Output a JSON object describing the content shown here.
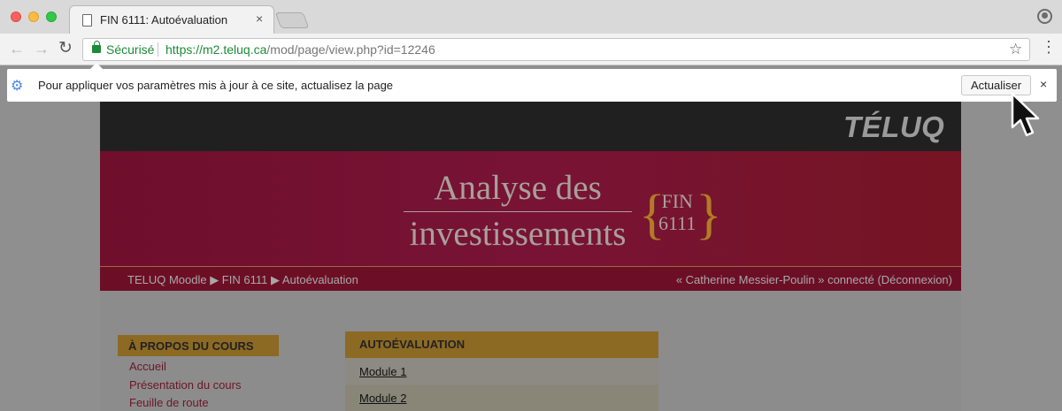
{
  "browser": {
    "tab_title": "FIN 6111: Autoévaluation",
    "close_glyph": "×",
    "secure_label": "Sécurisé",
    "url_host": "https://m2.teluq.ca",
    "url_path": "/mod/page/view.php?id=12246"
  },
  "infobar": {
    "message": "Pour appliquer vos paramètres mis à jour à ce site, actualisez la page",
    "button_label": "Actualiser",
    "close_glyph": "×"
  },
  "site": {
    "logo": "TÉLUQ",
    "course_title_line1": "Analyse des",
    "course_title_line2": "investissements",
    "course_code_line1": "FIN",
    "course_code_line2": "6111",
    "breadcrumb": "TELUQ Moodle ▶ FIN 6111 ▶ Autoévaluation",
    "user_status": "« Catherine Messier-Poulin » connecté (Déconnexion)"
  },
  "sidebar": {
    "heading": "À PROPOS DU COURS",
    "links": [
      "Accueil",
      "Présentation du cours",
      "Feuille de route"
    ]
  },
  "main": {
    "heading": "AUTOÉVALUATION",
    "modules": [
      "Module 1",
      "Module 2"
    ]
  },
  "colors": {
    "secure_green": "#1d8a36",
    "banner_crimson": "#781336",
    "accent_gold": "#b17c25"
  }
}
